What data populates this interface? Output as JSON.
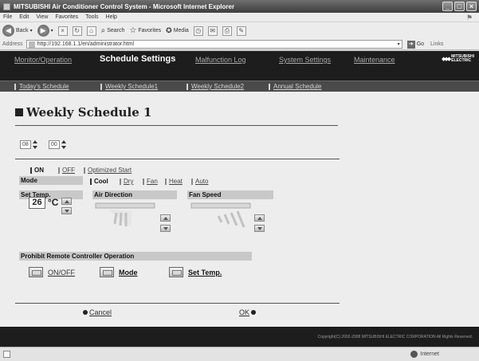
{
  "browser": {
    "title": "MITSUBISHI Air Conditioner Control System - Microsoft Internet Explorer",
    "menu": [
      "File",
      "Edit",
      "View",
      "Favorites",
      "Tools",
      "Help"
    ],
    "toolbar": {
      "back": "Back",
      "search": "Search",
      "favorites": "Favorites",
      "media": "Media"
    },
    "address_label": "Address",
    "address_value": "http://192.168.1.1/en/administrator.html",
    "go": "Go",
    "links": "Links",
    "status_zone": "Internet"
  },
  "nav": {
    "tabs": [
      "Monitor/Operation",
      "Schedule Settings",
      "Malfunction Log",
      "System Settings",
      "Maintenance"
    ],
    "active": "Schedule Settings",
    "brand": [
      "MITSUBISHI",
      "ELECTRIC"
    ],
    "subtabs": [
      "Today's Schedule",
      "Weekly Schedule1",
      "Weekly Schedule2",
      "Annual Schedule"
    ]
  },
  "page": {
    "title": "Weekly Schedule 1",
    "hour": "08",
    "minute": "00",
    "onoff": {
      "on": "ON",
      "off": "OFF",
      "optimized": "Optimized Start",
      "selected": "ON"
    },
    "mode": {
      "label": "Mode",
      "options": [
        "Cool",
        "Dry",
        "Fan",
        "Heat",
        "Auto"
      ],
      "selected": "Cool"
    },
    "set_temp": {
      "label": "Set Temp.",
      "value": "26",
      "unit": "°C"
    },
    "air_direction": {
      "label": "Air Direction"
    },
    "fan_speed": {
      "label": "Fan Speed"
    },
    "prohibit": {
      "label": "Prohibit Remote Controller Operation",
      "items": [
        "ON/OFF",
        "Mode",
        "Set Temp."
      ]
    },
    "cancel": "Cancel",
    "ok": "OK"
  },
  "footer": {
    "copyright": "Copyright(C) 2002-2008 MITSUBISHI ELECTRIC CORPORATION All Rights Reserved."
  }
}
